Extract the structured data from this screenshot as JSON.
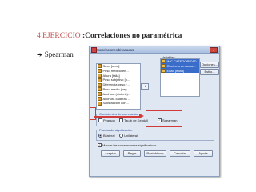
{
  "slide": {
    "heading_num": "4 EJERCICIO",
    "heading_rest": ":Correlaciones no paramétrica",
    "bullet_arrow": "➔",
    "bullet_text": "Spearman"
  },
  "dialog": {
    "title": "Correlaciones bivariadas",
    "close_glyph": "×",
    "source_vars": [
      "Sexo [sexo]",
      "Peso medido en...",
      "Altura [talla]",
      "Peso subjetivo [p...",
      "Diferencia peso r...",
      "Peso medio (ceg...",
      "Anchura (sinteric)...",
      "Anchura caderas ...",
      "Satisfacción con..."
    ],
    "variables_label": "Variables:",
    "selected_vars": [
      "IMC CATEGORIZAD...",
      "Obcierna en acera...",
      "Edad [edad]"
    ],
    "move_glyph": "➔",
    "side_buttons": [
      "Opciones...",
      "Estilo..."
    ],
    "coef_legend": "Coeficientes de correlación",
    "coef_options": [
      {
        "label": "Pearson",
        "checked": false
      },
      {
        "label": "Tau-b de Kendall",
        "checked": false
      },
      {
        "label": "Spearman",
        "checked": true
      }
    ],
    "sig_legend": "Prueba de significación",
    "sig_options": [
      {
        "label": "Bilateral",
        "selected": true
      },
      {
        "label": "Unilateral",
        "selected": false
      }
    ],
    "flag_label": "Marcar las correlaciones significativas",
    "flag_checked": true,
    "bottom_buttons": [
      "Aceptar",
      "Pegar",
      "Restablecer",
      "Cancelar",
      "Ayuda"
    ]
  }
}
